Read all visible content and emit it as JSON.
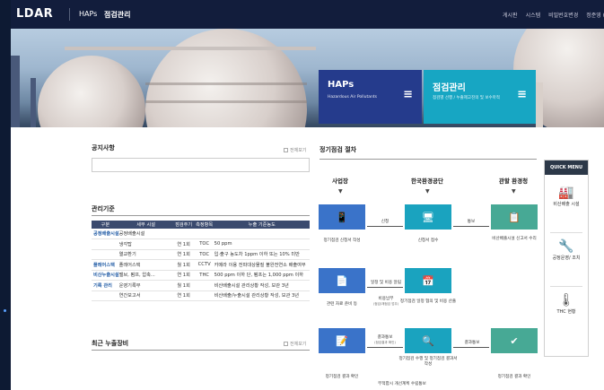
{
  "nav": {
    "logo": "LDAR",
    "menu": [
      "HAPs",
      "점검관리"
    ],
    "right": [
      "게시판",
      "시스템",
      "비밀번호변경",
      "정준영 (산업융합"
    ]
  },
  "hero": {
    "card1": {
      "title": "HAPs",
      "sub": "Hazardous Air Pollutants",
      "icon": "menu-icon"
    },
    "card2": {
      "title": "점검관리",
      "sub": "점검별 선행 / 누출제고진의 및 보수마적",
      "icon": "menu-icon"
    }
  },
  "notice": {
    "title": "공지사항",
    "more": "전체보기"
  },
  "mgmt": {
    "title": "관리기준",
    "headers": [
      "구분",
      "세부 시설",
      "점검주기",
      "측정항목",
      "누출 기준농도"
    ],
    "rows": [
      {
        "cat": "공정배출시설",
        "fac": "공정배출시설",
        "cycle": "",
        "item": "",
        "crit": ""
      },
      {
        "cat": "",
        "fac": "냉각탑",
        "cycle": "연 1회",
        "item": "TOC",
        "crit": "50 ppm"
      },
      {
        "cat": "",
        "fac": "열교환기",
        "cycle": "연 1회",
        "item": "TOC",
        "crit": "입·출구 농도차 1ppm 이하 또는 10% 미만"
      },
      {
        "cat": "플레어스택",
        "fac": "플레어스택",
        "cycle": "월 1회",
        "item": "CCTV",
        "crit": "카메라 이용 전파대상물질 불완전연소 배출여부"
      },
      {
        "cat": "비산누출시설",
        "fac": "밸브, 펌프, 압축...",
        "cycle": "연 1회",
        "item": "THC",
        "crit": "500 ppm 이하 단, 펌프는 1,000 ppm 이하"
      },
      {
        "cat": "기록 관리",
        "fac": "운영기록부",
        "cycle": "월 1회",
        "item": "",
        "crit": "비산배출시설 관리상황 작성, 보관 3년"
      },
      {
        "cat": "",
        "fac": "연간보고서",
        "cycle": "연 1회",
        "item": "",
        "crit": "비산배출/누출시설 관리상황 작성, 보관 3년"
      }
    ]
  },
  "leak": {
    "title": "최근 누출장비",
    "more": "전체보기"
  },
  "proc": {
    "title": "정기점검 절차",
    "cols": [
      "사업장",
      "한국환경공단",
      "관할 환경청"
    ],
    "labels": [
      "정기점검 신청서 작성",
      "신청서 접수",
      "비산배출시설 신고서 수리",
      "관련 자료 준비 등",
      "정기점검 일정 협의 및 비용 산출",
      "정기점검 결과 확인",
      "정기점검 수행 및 정기점검 결과서 작성",
      "정기점검 결과 확인"
    ],
    "conn": {
      "apply": "신청",
      "notify": "통보",
      "schedule": "일정 및 비용 알림",
      "cost_pay": "비용납부",
      "cost_note": "(점검/재점검 업무)",
      "result1": "결과통보",
      "result1_note": "(점검결과 확인)",
      "result2": "결과통보",
      "plan": "부적합시 개선계획 수립통보"
    }
  },
  "quick": {
    "title": "QUICK MENU",
    "items": [
      "비산배출 시설",
      "공정운영/ 조치",
      "THC 현황"
    ]
  }
}
